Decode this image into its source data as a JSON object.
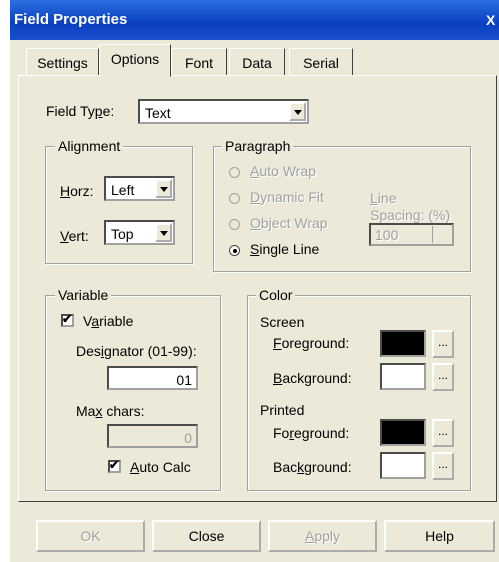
{
  "window": {
    "title": "Field Properties",
    "close_glyph": "X"
  },
  "tabs": [
    {
      "label": "Settings"
    },
    {
      "label": "Options",
      "active": true
    },
    {
      "label": "Font"
    },
    {
      "label": "Data"
    },
    {
      "label": "Serial"
    }
  ],
  "field_type": {
    "label": "Field Type:",
    "value": "Text"
  },
  "alignment": {
    "legend": "Alignment",
    "horz_label": "Horz:",
    "horz_value": "Left",
    "vert_label": "Vert:",
    "vert_value": "Top"
  },
  "paragraph": {
    "legend": "Paragraph",
    "options": [
      {
        "label": "Auto Wrap",
        "enabled": false,
        "selected": false
      },
      {
        "label": "Dynamic Fit",
        "enabled": false,
        "selected": false
      },
      {
        "label": "Object Wrap",
        "enabled": false,
        "selected": false
      },
      {
        "label": "Single Line",
        "enabled": true,
        "selected": true
      }
    ],
    "line_spacing_label_1": "Line",
    "line_spacing_label_2": "Spacing: (%)",
    "line_spacing_value": "100"
  },
  "variable": {
    "legend": "Variable",
    "checkbox_label": "Variable",
    "checked": true,
    "designator_label": "Designator (01-99):",
    "designator_value": "01",
    "max_chars_label": "Max chars:",
    "max_chars_value": "0",
    "auto_calc_label": "Auto Calc",
    "auto_calc_checked": true
  },
  "color": {
    "legend": "Color",
    "screen_label": "Screen",
    "printed_label": "Printed",
    "foreground_label": "Foreground:",
    "background_label": "Background:",
    "ellipsis": "...",
    "screen_foreground": "#000000",
    "screen_background": "#ffffff",
    "printed_foreground": "#000000",
    "printed_background": "#ffffff"
  },
  "buttons": {
    "ok": "OK",
    "close": "Close",
    "apply": "Apply",
    "help": "Help"
  }
}
